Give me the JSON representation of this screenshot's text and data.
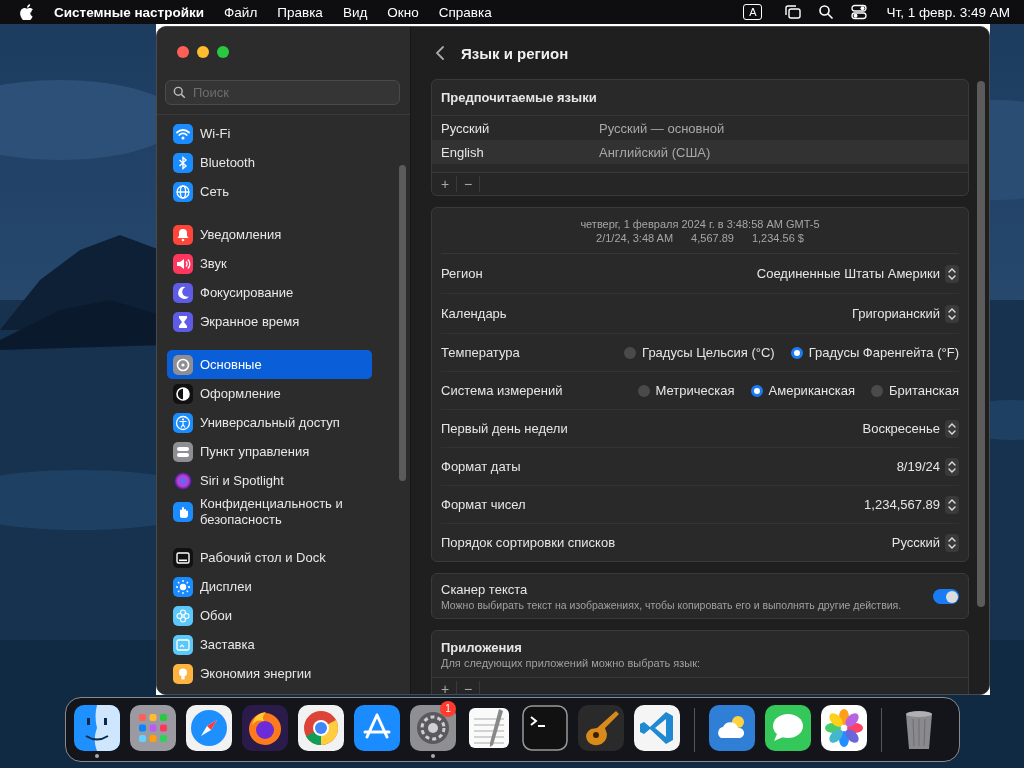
{
  "menubar": {
    "app": "Системные настройки",
    "menus": [
      "Файл",
      "Правка",
      "Вид",
      "Окно",
      "Справка"
    ],
    "input_source": "A",
    "clock": "Чт, 1 февр. 3:49 AM"
  },
  "sidebar": {
    "search": {
      "placeholder": "Поиск"
    },
    "groups": [
      {
        "items": [
          {
            "label": "Wi-Fi",
            "kind": "wifi",
            "selected": false
          },
          {
            "label": "Bluetooth",
            "kind": "bluetooth",
            "selected": false
          },
          {
            "label": "Сеть",
            "kind": "globe",
            "selected": false
          }
        ]
      },
      {
        "items": [
          {
            "label": "Уведомления",
            "kind": "bell",
            "selected": false
          },
          {
            "label": "Звук",
            "kind": "speaker",
            "selected": false
          },
          {
            "label": "Фокусирование",
            "kind": "moon",
            "selected": false
          },
          {
            "label": "Экранное время",
            "kind": "hourglass",
            "selected": false
          }
        ]
      },
      {
        "items": [
          {
            "label": "Основные",
            "kind": "gear",
            "selected": true
          },
          {
            "label": "Оформление",
            "kind": "contrast",
            "selected": false
          },
          {
            "label": "Универсальный доступ",
            "kind": "accessibility",
            "selected": false
          },
          {
            "label": "Пункт управления",
            "kind": "toggles",
            "selected": false
          },
          {
            "label": "Siri и Spotlight",
            "kind": "siri",
            "selected": false
          },
          {
            "label": "Конфиденциальность и безопасность",
            "kind": "hand",
            "selected": false
          }
        ]
      },
      {
        "items": [
          {
            "label": "Рабочий стол и Dock",
            "kind": "dock",
            "selected": false
          },
          {
            "label": "Дисплеи",
            "kind": "sun",
            "selected": false
          },
          {
            "label": "Обои",
            "kind": "flower",
            "selected": false
          },
          {
            "label": "Заставка",
            "kind": "screensaver",
            "selected": false
          },
          {
            "label": "Экономия энергии",
            "kind": "bulb",
            "selected": false
          }
        ]
      }
    ]
  },
  "page": {
    "title": "Язык и регион"
  },
  "languages": {
    "title": "Предпочитаемые языки",
    "rows": [
      {
        "name": "Русский",
        "description": "Русский — основной"
      },
      {
        "name": "English",
        "description": "Английский (США)"
      }
    ],
    "buttons": [
      "+",
      "−"
    ]
  },
  "region": {
    "preview": [
      "четверг, 1 февраля 2024 г. в 3:48:58 AM GMT-5"
    ],
    "preview_parts": [
      "2/1/24, 3:48 AM",
      "4,567.89",
      "1,234.56 $"
    ],
    "rows": [
      {
        "kind": "popup",
        "label": "Регион",
        "value": "Соединенные Штаты Америки"
      },
      {
        "kind": "popup",
        "label": "Календарь",
        "value": "Григорианский"
      },
      {
        "kind": "radio",
        "label": "Температура",
        "options": [
          {
            "label": "Градусы Цельсия (°C)",
            "selected": false
          },
          {
            "label": "Градусы Фаренгейта (°F)",
            "selected": true
          }
        ]
      },
      {
        "kind": "radio",
        "label": "Система измерений",
        "options": [
          {
            "label": "Метрическая",
            "selected": false
          },
          {
            "label": "Американская",
            "selected": true
          },
          {
            "label": "Британская",
            "selected": false
          }
        ]
      },
      {
        "kind": "popup",
        "label": "Первый день недели",
        "value": "Воскресенье"
      },
      {
        "kind": "popup",
        "label": "Формат даты",
        "value": "8/19/24"
      },
      {
        "kind": "popup",
        "label": "Формат чисел",
        "value": "1,234,567.89"
      },
      {
        "kind": "popup",
        "label": "Порядок сортировки списков",
        "value": "Русский"
      }
    ]
  },
  "text_scanner": {
    "title": "Сканер текста",
    "description": "Можно выбирать текст на изображениях, чтобы копировать его и выполнять другие действия.",
    "on": true
  },
  "apps": {
    "title": "Приложения",
    "description": "Для следующих приложений можно выбрать язык:",
    "buttons": [
      "+",
      "−"
    ]
  },
  "dock": {
    "items": [
      {
        "kind": "finder",
        "running": true
      },
      {
        "kind": "launchpad",
        "running": false
      },
      {
        "kind": "safari",
        "running": false
      },
      {
        "kind": "firefox",
        "running": false
      },
      {
        "kind": "chrome",
        "running": false
      },
      {
        "kind": "appstore",
        "running": false
      },
      {
        "kind": "settings",
        "running": true,
        "badge": "1"
      },
      {
        "kind": "textedit",
        "running": false
      },
      {
        "kind": "terminal",
        "running": false
      },
      {
        "kind": "guitar",
        "running": false
      },
      {
        "kind": "vscode",
        "running": false
      },
      {
        "kind": "separator"
      },
      {
        "kind": "weather",
        "running": false
      },
      {
        "kind": "messages",
        "running": false
      },
      {
        "kind": "photos",
        "running": false
      },
      {
        "kind": "separator"
      },
      {
        "kind": "trash",
        "running": false
      }
    ]
  }
}
